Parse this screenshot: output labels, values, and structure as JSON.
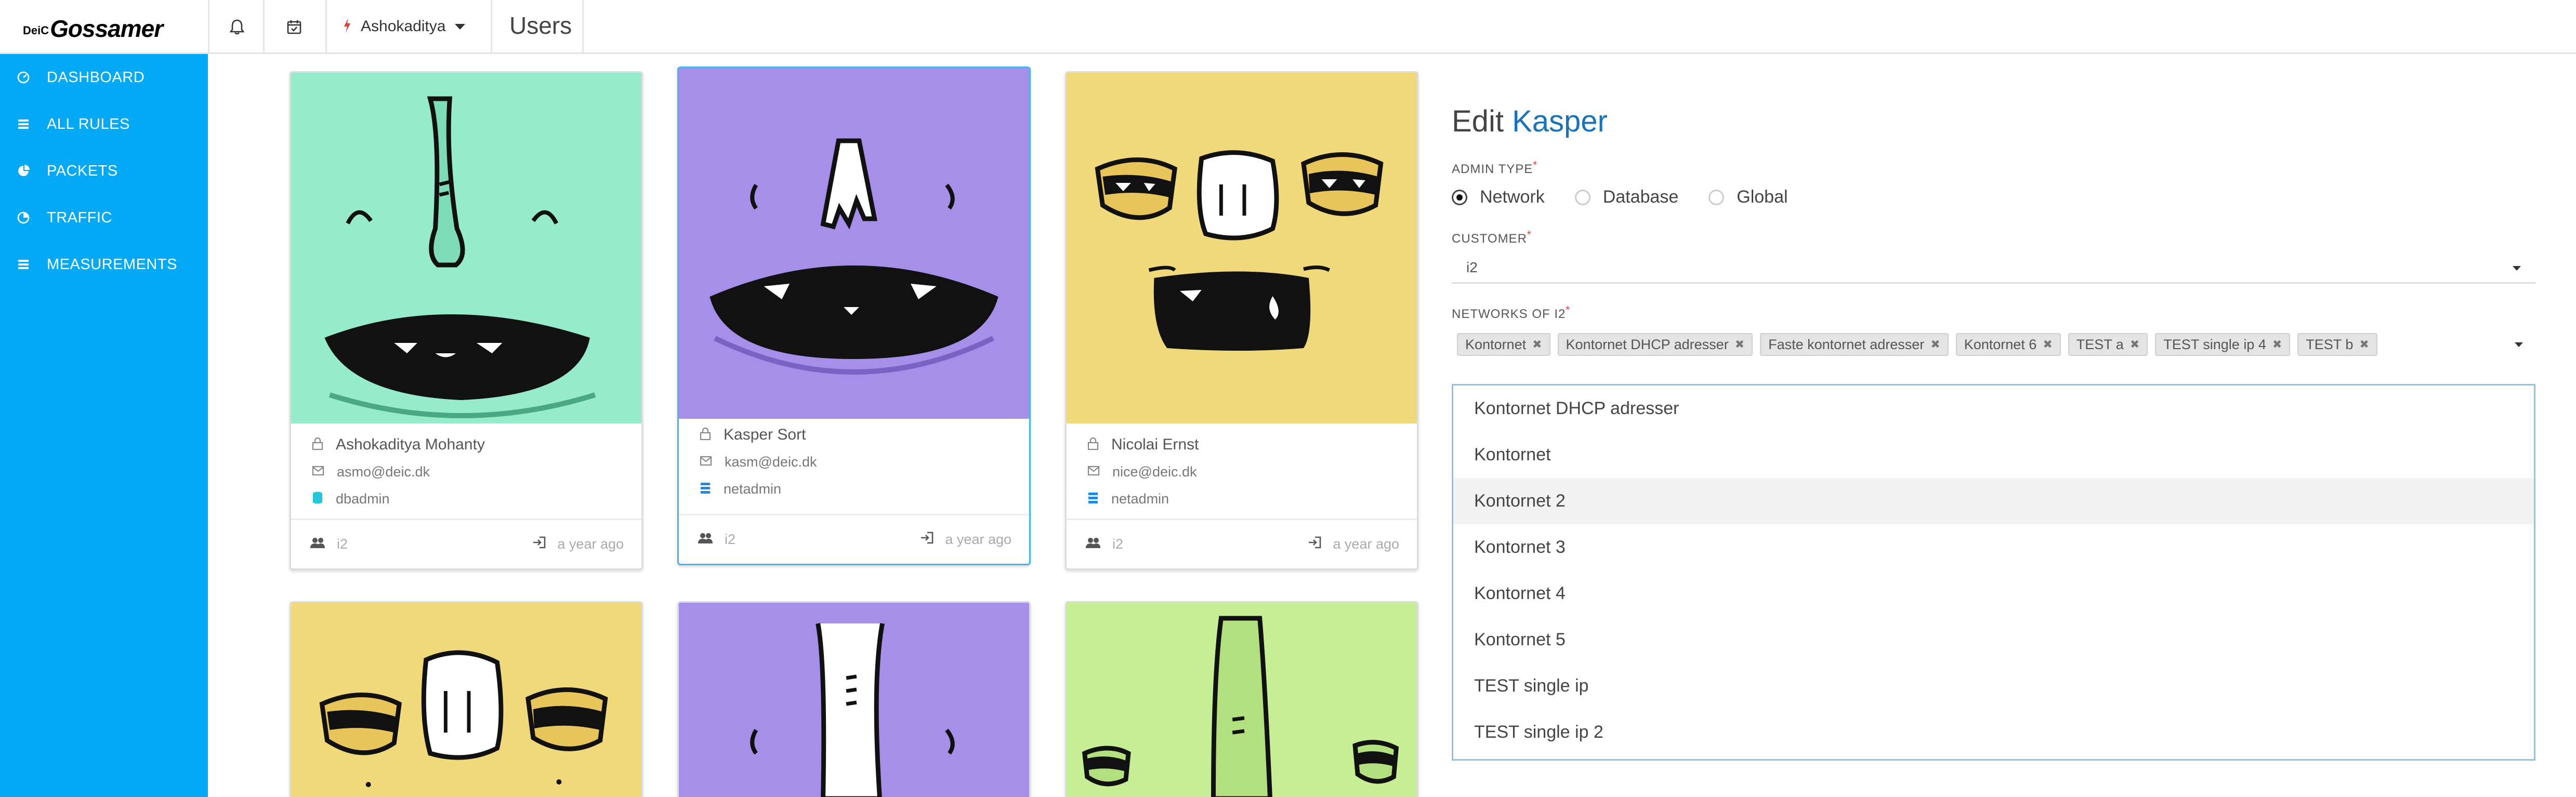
{
  "brand": {
    "small": "DeiC",
    "big": "Gossamer"
  },
  "topbar": {
    "user_name": "Ashokaditya",
    "page_title": "Users"
  },
  "sidebar": {
    "items": [
      {
        "label": "DASHBOARD",
        "icon": "dashboard-icon"
      },
      {
        "label": "ALL RULES",
        "icon": "list-icon"
      },
      {
        "label": "PACKETS",
        "icon": "pie-chart-icon"
      },
      {
        "label": "TRAFFIC",
        "icon": "traffic-icon"
      },
      {
        "label": "MEASUREMENTS",
        "icon": "list-icon"
      }
    ]
  },
  "cards": [
    {
      "name": "Ashokaditya Mohanty",
      "email": "asmo@deic.dk",
      "role": "dbadmin",
      "customer": "i2",
      "last_seen": "a year ago",
      "color": "#96ecca"
    },
    {
      "name": "Kasper Sort",
      "email": "kasm@deic.dk",
      "role": "netadmin",
      "customer": "i2",
      "last_seen": "a year ago",
      "color": "#a68fe8"
    },
    {
      "name": "Nicolai Ernst",
      "email": "nice@deic.dk",
      "role": "netadmin",
      "customer": "i2",
      "last_seen": "a year ago",
      "color": "#efd97a"
    }
  ],
  "partial_cards": [
    {
      "color": "#efd97a"
    },
    {
      "color": "#a68fe8"
    },
    {
      "color": "#c6ee95"
    }
  ],
  "edit": {
    "title_prefix": "Edit",
    "title_name": "Kasper",
    "admin_type_label": "ADMIN TYPE",
    "admin_types": [
      {
        "label": "Network",
        "selected": true
      },
      {
        "label": "Database",
        "selected": false
      },
      {
        "label": "Global",
        "selected": false
      }
    ],
    "customer_label": "CUSTOMER",
    "customer_value": "i2",
    "networks_label": "NETWORKS OF I2",
    "selected_networks": [
      "Kontornet",
      "Kontornet DHCP adresser",
      "Faste kontornet adresser",
      "Kontornet 6",
      "TEST a",
      "TEST single ip 4",
      "TEST b"
    ],
    "dropdown_options": [
      "Kontornet DHCP adresser",
      "Kontornet",
      "Kontornet 2",
      "Kontornet 3",
      "Kontornet 4",
      "Kontornet 5",
      "TEST single ip",
      "TEST single ip 2"
    ],
    "highlighted_option": "Kontornet 2"
  },
  "colors": {
    "sidebar": "#03a9f4",
    "accent_name": "#1a73b8",
    "required": "#e53935",
    "dropdown_border": "#89c4ea"
  }
}
